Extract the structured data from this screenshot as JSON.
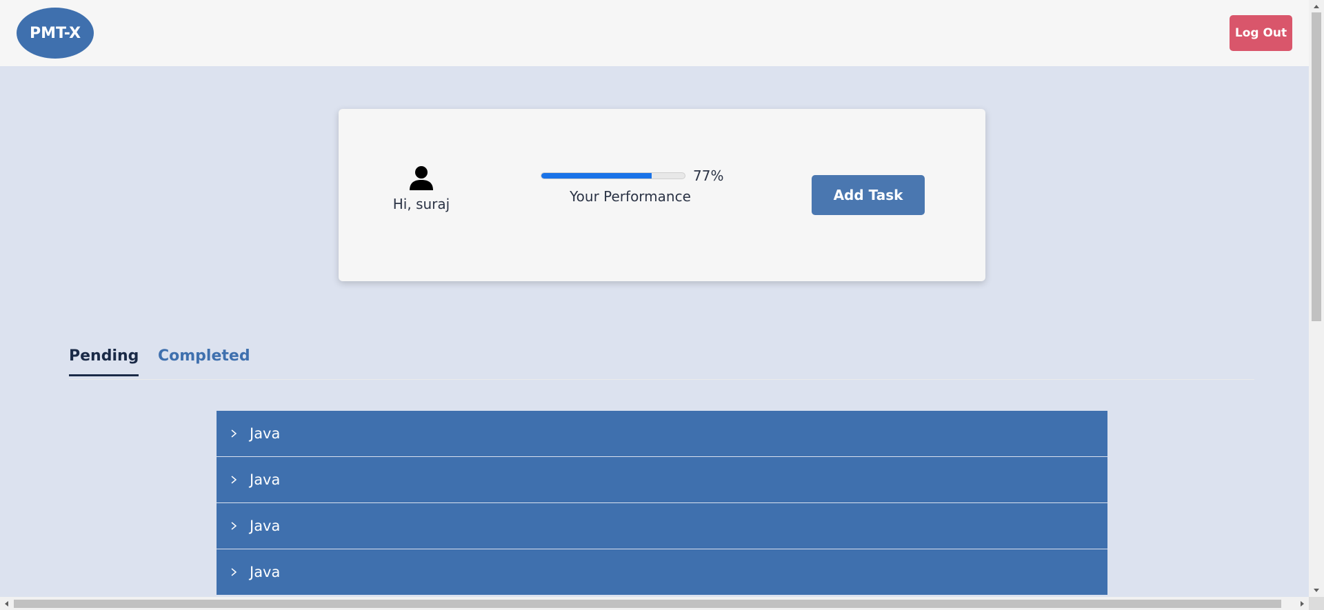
{
  "navbar": {
    "logo_text": "PMT-X",
    "logout_label": "Log Out"
  },
  "profile": {
    "user_icon": "user-icon",
    "greeting": "Hi, suraj"
  },
  "performance": {
    "percent": 77,
    "percent_text": "77%",
    "label": "Your Performance",
    "bar_color": "#1a73e8"
  },
  "actions": {
    "add_task_label": "Add Task"
  },
  "tabs": [
    {
      "label": "Pending",
      "active": true
    },
    {
      "label": "Completed",
      "active": false
    }
  ],
  "tasks": [
    {
      "label": "Java"
    },
    {
      "label": "Java"
    },
    {
      "label": "Java"
    },
    {
      "label": "Java"
    }
  ],
  "colors": {
    "brand": "#3f70ae",
    "logout": "#d9566b",
    "background": "#dce2ef",
    "active_tab": "#1a2a47"
  }
}
